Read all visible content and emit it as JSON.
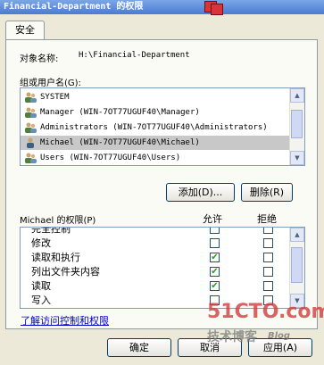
{
  "window": {
    "title": "Financial-Department 的权限"
  },
  "tabs": [
    {
      "label": "安全"
    }
  ],
  "object": {
    "label": "对象名称:",
    "value": "H:\\Financial-Department"
  },
  "groups": {
    "label": "组或用户名(G):",
    "items": [
      {
        "name": "SYSTEM",
        "selected": false
      },
      {
        "name": "Manager (WIN-7OT77UGUF40\\Manager)",
        "selected": false
      },
      {
        "name": "Administrators (WIN-7OT77UGUF40\\Administrators)",
        "selected": false
      },
      {
        "name": "Michael (WIN-7OT77UGUF40\\Michael)",
        "selected": true
      },
      {
        "name": "Users (WIN-7OT77UGUF40\\Users)",
        "selected": false
      }
    ]
  },
  "buttons": {
    "add": "添加(D)...",
    "remove": "删除(R)",
    "ok": "确定",
    "cancel": "取消",
    "apply": "应用(A)"
  },
  "permissions": {
    "label": "Michael 的权限(P)",
    "allow_header": "允许",
    "deny_header": "拒绝",
    "rows": [
      {
        "name": "完全控制",
        "allow": false,
        "deny": false
      },
      {
        "name": "修改",
        "allow": false,
        "deny": false
      },
      {
        "name": "读取和执行",
        "allow": true,
        "deny": false
      },
      {
        "name": "列出文件夹内容",
        "allow": true,
        "deny": false
      },
      {
        "name": "读取",
        "allow": true,
        "deny": false
      },
      {
        "name": "写入",
        "allow": false,
        "deny": false
      }
    ]
  },
  "link": "了解访问控制和权限",
  "watermark": {
    "line1": "51CTO.com",
    "line2": "技术博客",
    "line3": "Blog"
  },
  "colors": {
    "title_bar": "#4a7bd0",
    "selection": "#c8c8c8",
    "check": "#21a121",
    "watermark": "#d23c3c"
  }
}
